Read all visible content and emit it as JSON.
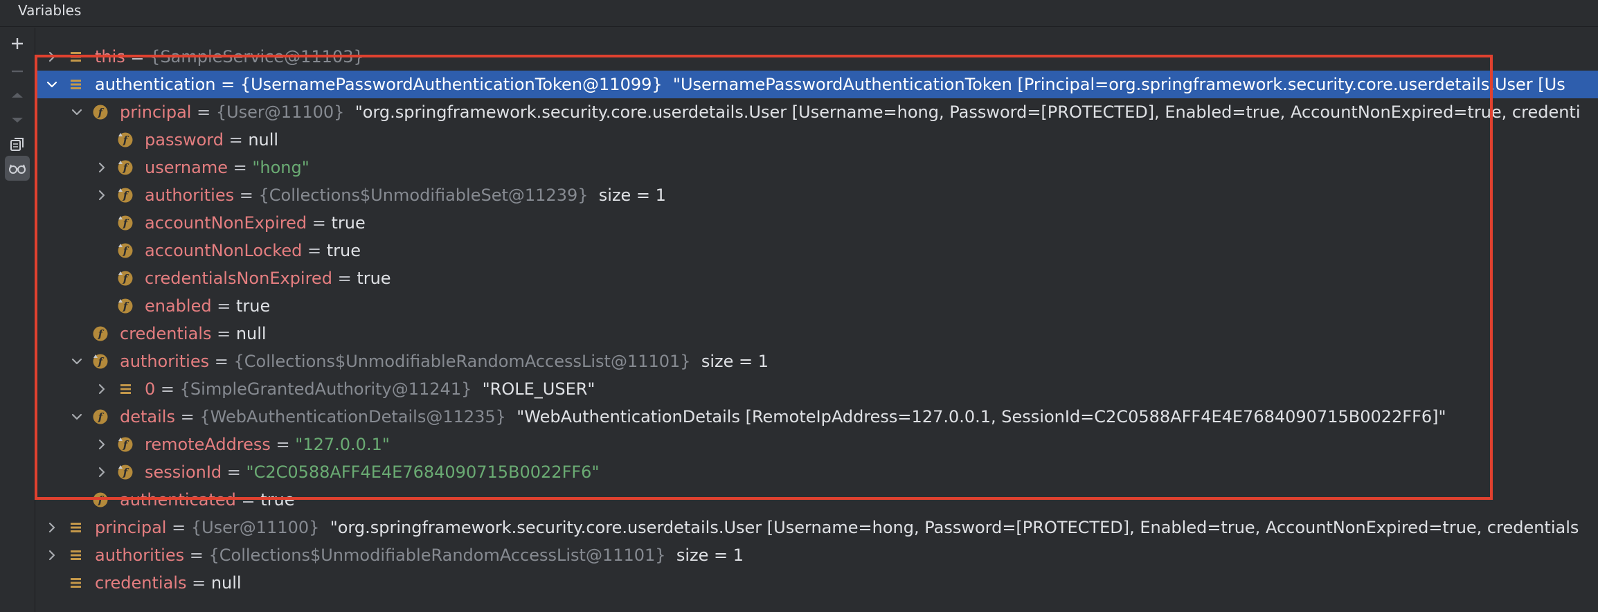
{
  "panel": {
    "title": "Variables"
  },
  "toolbar": [
    {
      "name": "add-watch-button",
      "icon": "plus-icon"
    },
    {
      "name": "remove-watch-button",
      "icon": "minus-icon"
    },
    {
      "name": "move-up-button",
      "icon": "triangle-up-icon"
    },
    {
      "name": "move-down-button",
      "icon": "triangle-down-icon"
    },
    {
      "name": "copy-button",
      "icon": "copy-icon"
    },
    {
      "name": "show-watches-button",
      "icon": "glasses-icon"
    }
  ],
  "rows": [
    {
      "depth": 0,
      "arrow": "right",
      "kind": "stack",
      "name": "this",
      "eq": " = ",
      "type": "{SampleService@11103}",
      "value": "",
      "value_kind": "",
      "selected": false
    },
    {
      "depth": 0,
      "arrow": "down",
      "kind": "stack",
      "name": "authentication",
      "eq": " = ",
      "type": "{UsernamePasswordAuthenticationToken@11099}",
      "value": "\"UsernamePasswordAuthenticationToken [Principal=org.springframework.security.core.userdetails.User [Us",
      "value_kind": "text",
      "selected": true
    },
    {
      "depth": 1,
      "arrow": "down",
      "kind": "field",
      "name": "principal",
      "eq": " = ",
      "type": "{User@11100}",
      "value": "\"org.springframework.security.core.userdetails.User [Username=hong, Password=[PROTECTED], Enabled=true, AccountNonExpired=true, credenti",
      "value_kind": "text",
      "selected": false
    },
    {
      "depth": 2,
      "arrow": "none",
      "kind": "field-final",
      "name": "password",
      "eq": " = ",
      "type": "",
      "value": "null",
      "value_kind": "text",
      "selected": false
    },
    {
      "depth": 2,
      "arrow": "right",
      "kind": "field-final",
      "name": "username",
      "eq": " = ",
      "type": "",
      "value": "\"hong\"",
      "value_kind": "string",
      "selected": false
    },
    {
      "depth": 2,
      "arrow": "right",
      "kind": "field-final",
      "name": "authorities",
      "eq": " = ",
      "type": "{Collections$UnmodifiableSet@11239}",
      "value": "size = 1",
      "value_kind": "text",
      "selected": false
    },
    {
      "depth": 2,
      "arrow": "none",
      "kind": "field-final",
      "name": "accountNonExpired",
      "eq": " = ",
      "type": "",
      "value": "true",
      "value_kind": "text",
      "selected": false
    },
    {
      "depth": 2,
      "arrow": "none",
      "kind": "field-final",
      "name": "accountNonLocked",
      "eq": " = ",
      "type": "",
      "value": "true",
      "value_kind": "text",
      "selected": false
    },
    {
      "depth": 2,
      "arrow": "none",
      "kind": "field-final",
      "name": "credentialsNonExpired",
      "eq": " = ",
      "type": "",
      "value": "true",
      "value_kind": "text",
      "selected": false
    },
    {
      "depth": 2,
      "arrow": "none",
      "kind": "field-final",
      "name": "enabled",
      "eq": " = ",
      "type": "",
      "value": "true",
      "value_kind": "text",
      "selected": false
    },
    {
      "depth": 1,
      "arrow": "none",
      "kind": "field",
      "name": "credentials",
      "eq": " = ",
      "type": "",
      "value": "null",
      "value_kind": "text",
      "selected": false
    },
    {
      "depth": 1,
      "arrow": "down",
      "kind": "field-final",
      "name": "authorities",
      "eq": " = ",
      "type": "{Collections$UnmodifiableRandomAccessList@11101}",
      "value": "size = 1",
      "value_kind": "text",
      "selected": false
    },
    {
      "depth": 2,
      "arrow": "right",
      "kind": "stack",
      "name": "0",
      "eq": " = ",
      "type": "{SimpleGrantedAuthority@11241}",
      "value": "\"ROLE_USER\"",
      "value_kind": "text",
      "selected": false
    },
    {
      "depth": 1,
      "arrow": "down",
      "kind": "field",
      "name": "details",
      "eq": " = ",
      "type": "{WebAuthenticationDetails@11235}",
      "value": "\"WebAuthenticationDetails [RemoteIpAddress=127.0.0.1, SessionId=C2C0588AFF4E4E7684090715B0022FF6]\"",
      "value_kind": "text",
      "selected": false
    },
    {
      "depth": 2,
      "arrow": "right",
      "kind": "field-final",
      "name": "remoteAddress",
      "eq": " = ",
      "type": "",
      "value": "\"127.0.0.1\"",
      "value_kind": "string",
      "selected": false
    },
    {
      "depth": 2,
      "arrow": "right",
      "kind": "field-final",
      "name": "sessionId",
      "eq": " = ",
      "type": "",
      "value": "\"C2C0588AFF4E4E7684090715B0022FF6\"",
      "value_kind": "string",
      "selected": false
    },
    {
      "depth": 1,
      "arrow": "none",
      "kind": "field",
      "name": "authenticated",
      "eq": " = ",
      "type": "",
      "value": "true",
      "value_kind": "text",
      "selected": false
    },
    {
      "depth": 0,
      "arrow": "right",
      "kind": "stack",
      "name": "principal",
      "eq": " = ",
      "type": "{User@11100}",
      "value": "\"org.springframework.security.core.userdetails.User [Username=hong, Password=[PROTECTED], Enabled=true, AccountNonExpired=true, credentials",
      "value_kind": "text",
      "selected": false
    },
    {
      "depth": 0,
      "arrow": "right",
      "kind": "stack",
      "name": "authorities",
      "eq": " = ",
      "type": "{Collections$UnmodifiableRandomAccessList@11101}",
      "value": "size = 1",
      "value_kind": "text",
      "selected": false
    },
    {
      "depth": 0,
      "arrow": "none",
      "kind": "stack",
      "name": "credentials",
      "eq": " = ",
      "type": "",
      "value": "null",
      "value_kind": "text",
      "selected": false
    }
  ],
  "colors": {
    "background": "#2b2d30",
    "selection": "#2e5ead",
    "highlight_box": "#e0412f",
    "variable_name": "#e57e80",
    "type_info": "#868a91",
    "string_value": "#6aab73",
    "field_icon": "#b48a3b"
  }
}
